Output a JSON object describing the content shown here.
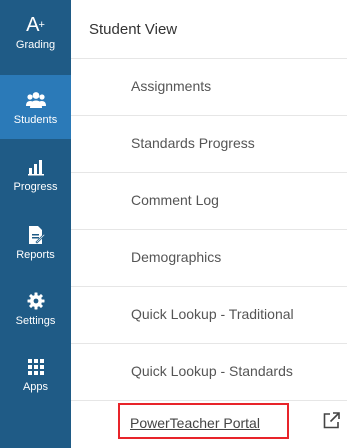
{
  "sidebar": {
    "items": [
      {
        "label": "Grading",
        "icon": "grading-icon",
        "active": false
      },
      {
        "label": "Students",
        "icon": "students-icon",
        "active": true
      },
      {
        "label": "Progress",
        "icon": "progress-icon",
        "active": false
      },
      {
        "label": "Reports",
        "icon": "reports-icon",
        "active": false
      },
      {
        "label": "Settings",
        "icon": "settings-icon",
        "active": false
      },
      {
        "label": "Apps",
        "icon": "apps-icon",
        "active": false
      }
    ],
    "grading_symbol": "A",
    "grading_symbol_sup": "+"
  },
  "header": {
    "title": "Student View"
  },
  "menu": {
    "items": [
      {
        "label": "Assignments"
      },
      {
        "label": "Standards Progress"
      },
      {
        "label": "Comment Log"
      },
      {
        "label": "Demographics"
      },
      {
        "label": "Quick Lookup - Traditional"
      },
      {
        "label": "Quick Lookup - Standards"
      }
    ],
    "portal_link": "PowerTeacher Portal",
    "portal_icon": "external-link-icon"
  },
  "colors": {
    "sidebar_bg": "#1f5b86",
    "sidebar_active": "#2b7ab8",
    "highlight_box": "#e8242a"
  }
}
